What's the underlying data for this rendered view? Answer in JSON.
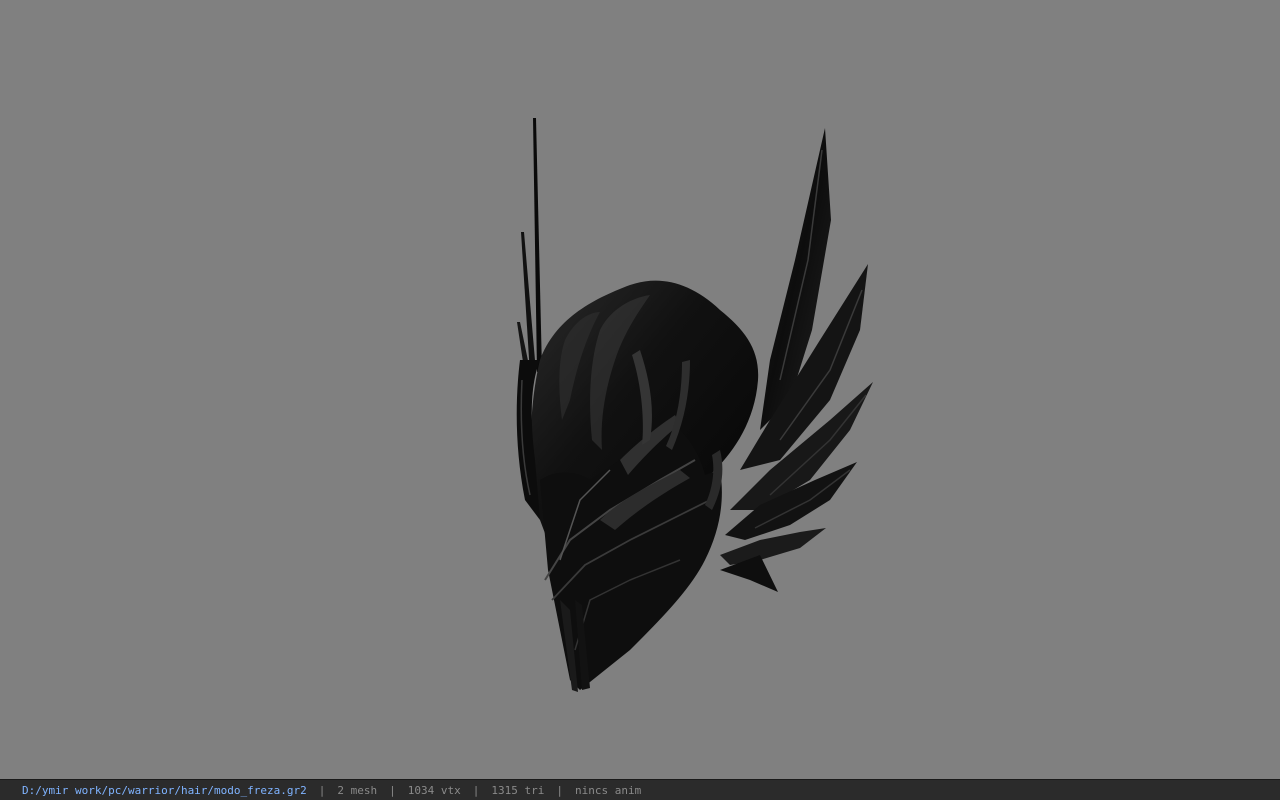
{
  "viewport": {
    "background": "#808080",
    "model_name": "helmet-model"
  },
  "statusbar": {
    "file_path": "D:/ymir work/pc/warrior/hair/modo_freza.gr2",
    "separator": "|",
    "mesh_count": "2 mesh",
    "vertex_count": "1034 vtx",
    "triangle_count": "1315 tri",
    "anim_status": "nincs anim",
    "path_color": "#7fb3ff",
    "text_color": "#8a8a8a"
  }
}
